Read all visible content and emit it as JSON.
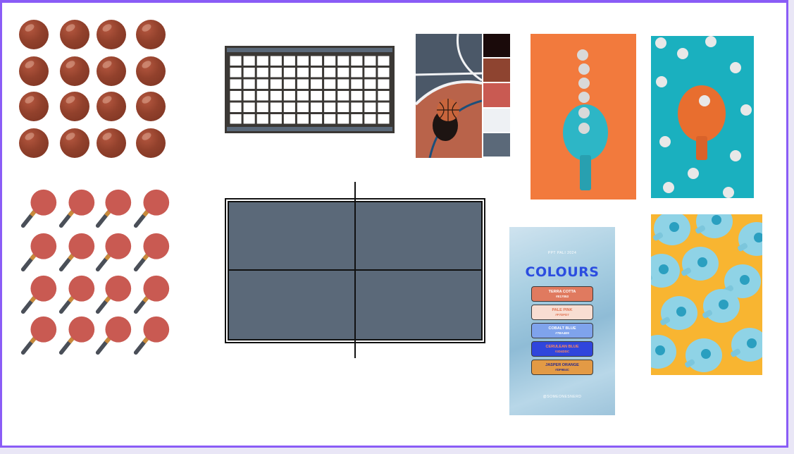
{
  "board": {
    "title": "",
    "accent": "#8a5cf6"
  },
  "assets": {
    "balls": {
      "rows": 4,
      "cols": 4,
      "color": "#92412c"
    },
    "paddles": {
      "rows": 4,
      "cols": 4,
      "color": "#c95a52",
      "handle": "#4a4f58"
    },
    "net": {
      "color": "#3b3835"
    },
    "table": {
      "color": "#5b6979",
      "line": "#111111"
    }
  },
  "mood": {
    "palette_swatches": [
      "#1a0a0a",
      "#8e4430",
      "#c95a52",
      "#eef1f4",
      "#5b6979"
    ],
    "colours_card": {
      "subtitle": "PPT PALI 2024",
      "title": "COLOURS",
      "footer": "@SOMEONESNERD",
      "chips": [
        {
          "name": "TERRA COTTA",
          "hex": "#E17053",
          "bg": "#e07a5f",
          "fg": "#ffffff"
        },
        {
          "name": "PALE PINK",
          "hex": "#F7DFD7",
          "bg": "#f8ddd2",
          "fg": "#e0704f"
        },
        {
          "name": "COBALT BLUE",
          "hex": "#7BA4E9",
          "bg": "#7fa3ec",
          "fg": "#ffffff"
        },
        {
          "name": "CERULEAN BLUE",
          "hex": "#3D4DDC",
          "bg": "#3046dc",
          "fg": "#ff8a5c"
        },
        {
          "name": "JASPER ORANGE",
          "hex": "#DF9E4C",
          "bg": "#e39a45",
          "fg": "#2a2a8a"
        }
      ]
    }
  }
}
